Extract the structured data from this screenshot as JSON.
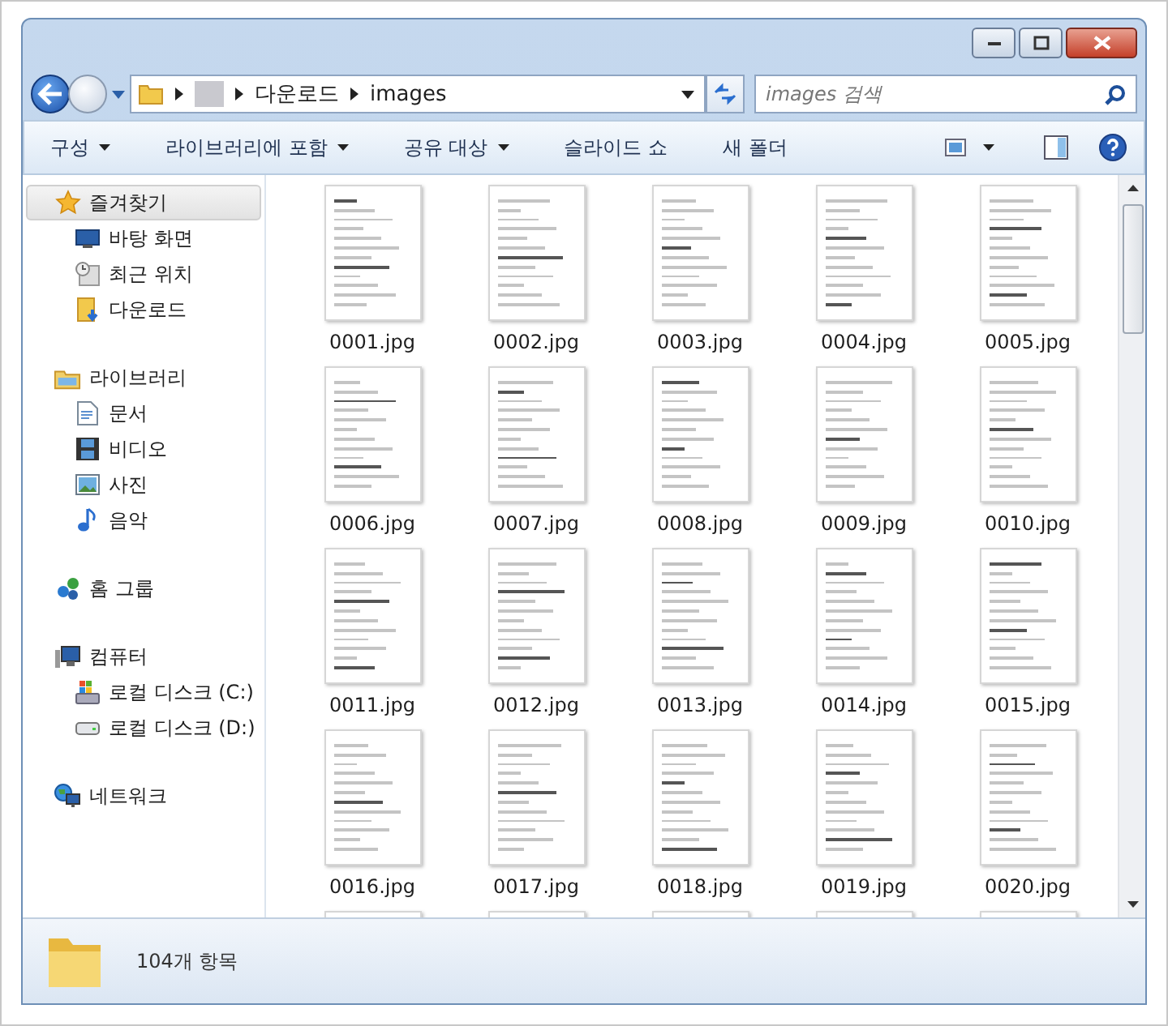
{
  "address_bar": {
    "segments": [
      "다운로드",
      "images"
    ]
  },
  "search": {
    "placeholder": "images 검색"
  },
  "toolbar": {
    "buttons": [
      {
        "label": "구성",
        "dropdown": true
      },
      {
        "label": "라이브러리에 포함",
        "dropdown": true
      },
      {
        "label": "공유 대상",
        "dropdown": true
      },
      {
        "label": "슬라이드 쇼",
        "dropdown": false
      },
      {
        "label": "새 폴더",
        "dropdown": false
      }
    ]
  },
  "sidebar": {
    "groups": [
      {
        "label": "즐겨찾기",
        "selected": true,
        "children": [
          {
            "label": "바탕 화면",
            "selected": false
          },
          {
            "label": "최근 위치",
            "selected": false
          },
          {
            "label": "다운로드",
            "selected": false
          }
        ]
      },
      {
        "label": "라이브러리",
        "selected": false,
        "children": [
          {
            "label": "문서",
            "selected": false
          },
          {
            "label": "비디오",
            "selected": false
          },
          {
            "label": "사진",
            "selected": false
          },
          {
            "label": "음악",
            "selected": false
          }
        ]
      },
      {
        "label": "홈 그룹",
        "selected": false
      },
      {
        "label": "컴퓨터",
        "selected": false,
        "children": [
          {
            "label": "로컬 디스크 (C:)",
            "selected": false
          },
          {
            "label": "로컬 디스크 (D:)",
            "selected": false
          }
        ]
      },
      {
        "label": "네트워크",
        "selected": false
      }
    ]
  },
  "files": [
    {
      "kind": "file",
      "name": "0001.jpg"
    },
    {
      "kind": "file",
      "name": "0002.jpg"
    },
    {
      "kind": "file",
      "name": "0003.jpg"
    },
    {
      "kind": "file",
      "name": "0004.jpg"
    },
    {
      "kind": "file",
      "name": "0005.jpg"
    },
    {
      "kind": "file",
      "name": "0006.jpg"
    },
    {
      "kind": "file",
      "name": "0007.jpg"
    },
    {
      "kind": "file",
      "name": "0008.jpg"
    },
    {
      "kind": "file",
      "name": "0009.jpg"
    },
    {
      "kind": "file",
      "name": "0010.jpg"
    },
    {
      "kind": "file",
      "name": "0011.jpg"
    },
    {
      "kind": "file",
      "name": "0012.jpg"
    },
    {
      "kind": "file",
      "name": "0013.jpg"
    },
    {
      "kind": "file",
      "name": "0014.jpg"
    },
    {
      "kind": "file",
      "name": "0015.jpg"
    },
    {
      "kind": "file",
      "name": "0016.jpg"
    },
    {
      "kind": "file",
      "name": "0017.jpg"
    },
    {
      "kind": "file",
      "name": "0018.jpg"
    },
    {
      "kind": "file",
      "name": "0019.jpg"
    },
    {
      "kind": "file",
      "name": "0020.jpg"
    },
    {
      "kind": "cut"
    },
    {
      "kind": "cut"
    },
    {
      "kind": "cut"
    },
    {
      "kind": "cut"
    },
    {
      "kind": "cut"
    }
  ],
  "details_pane": {
    "count": "104개 항목"
  }
}
